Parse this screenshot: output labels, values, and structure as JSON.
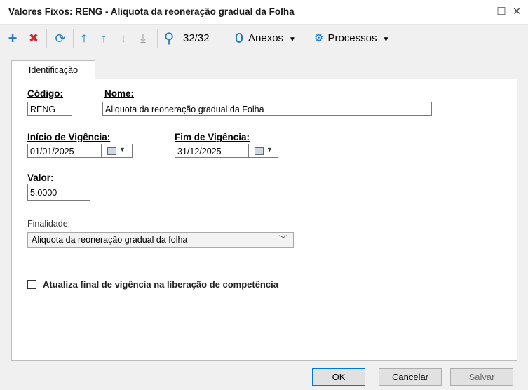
{
  "window": {
    "title": "Valores Fixos: RENG - Aliquota da reoneração gradual da Folha",
    "maximize_glyph": "☐",
    "close_glyph": "✕"
  },
  "toolbar": {
    "add_glyph": "+",
    "delete_glyph": "✖",
    "refresh_glyph": "⟳",
    "first_glyph": "⤒",
    "prev_glyph": "↑",
    "next_glyph": "↓",
    "last_glyph": "⤓",
    "search_glyph": "⚲",
    "record_counter": "32/32",
    "anexos_label": "Anexos",
    "processos_label": "Processos",
    "caret_glyph": "▼"
  },
  "tabs": [
    {
      "label": "Identificação"
    }
  ],
  "form": {
    "codigo_label": "Código:",
    "codigo_value": "RENG",
    "nome_label": "Nome:",
    "nome_value": "Aliquota da reoneração gradual da Folha",
    "inicio_label": "Início de Vigência:",
    "inicio_value": "01/01/2025",
    "fim_label": "Fim de Vigência:",
    "fim_value": "31/12/2025",
    "valor_label": "Valor:",
    "valor_value": "5,0000",
    "finalidade_label": "Finalidade:",
    "finalidade_value": "Aliquota da reoneração gradual  da folha",
    "checkbox_label": "Atualiza final de vigência na liberação de competência",
    "checkbox_checked": false
  },
  "buttons": {
    "ok": "OK",
    "cancel": "Cancelar",
    "save": "Salvar"
  },
  "colors": {
    "add": "#1f78c8",
    "delete": "#d9262b",
    "nav": "#1f78c8",
    "accent": "#0078d7"
  }
}
